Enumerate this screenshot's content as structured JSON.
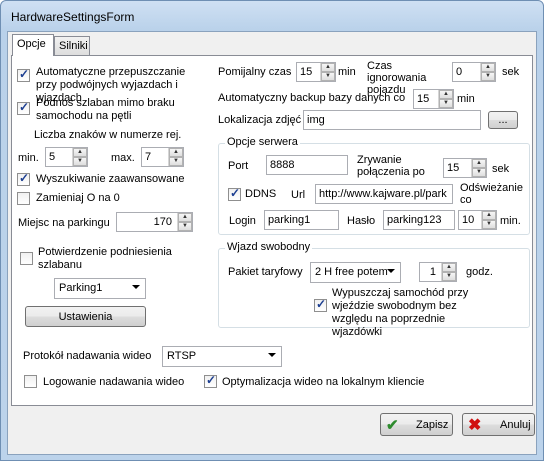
{
  "window": {
    "title": "HardwareSettingsForm"
  },
  "tabs": [
    {
      "label": "Opcje"
    },
    {
      "label": "Silniki"
    }
  ],
  "left": {
    "auto_pass": "Automatyczne przepuszczanie przy podwójnych wyjazdach i wjazdach",
    "raise_barrier": "Podnoś szlaban mimo braku samochodu na pętli",
    "plate_chars": "Liczba znaków w numerze rej.",
    "min_label": "min.",
    "min_value": "5",
    "max_label": "max.",
    "max_value": "7",
    "advanced_search": "Wyszukiwanie zaawansowane",
    "replace_o": "Zamieniaj O na 0",
    "parking_spaces_label": "Miejsc na parkingu",
    "parking_spaces_value": "170",
    "confirm_raise": "Potwierdzenie podniesienia szlabanu",
    "parking_select": "Parking1",
    "settings_button": "Ustawienia"
  },
  "right": {
    "photo_time_label": "Pomijalny czas",
    "photo_time_value": "15",
    "photo_time_unit": "min",
    "ignore_time_label": "Czas ignorowania pojazdu",
    "ignore_time_value": "0",
    "ignore_time_unit": "sek",
    "backup_label": "Automatyczny backup bazy danych co",
    "backup_value": "15",
    "backup_unit": "min",
    "photo_loc_label": "Lokalizacja zdjęć",
    "photo_loc_value": "img",
    "browse_button": "...",
    "server_group": "Opcje serwera",
    "port_label": "Port",
    "port_value": "8888",
    "drop_label": "Zrywanie połączenia po",
    "drop_value": "15",
    "drop_unit": "sek",
    "ddns_label": "DDNS",
    "url_label": "Url",
    "url_value": "http://www.kajware.pl/park",
    "refresh_label": "Odświeżanie co",
    "login_label": "Login",
    "login_value": "parking1",
    "password_label": "Hasło",
    "password_value": "parking123",
    "refresh_value": "10",
    "refresh_unit": "min.",
    "free_group": "Wjazd swobodny",
    "tariff_label": "Pakiet taryfowy",
    "tariff_value": "2 H free potem",
    "hours_value": "1",
    "hours_unit": "godz.",
    "release_label": "Wypuszczaj samochód przy wjeździe swobodnym bez względu na poprzednie wjazdówki"
  },
  "bottom": {
    "protocol_label": "Protokół nadawania wideo",
    "protocol_value": "RTSP",
    "log_video": "Logowanie nadawania wideo",
    "optimize_video": "Optymalizacja wideo na lokalnym kliencie"
  },
  "footer": {
    "save": "Zapisz",
    "cancel": "Anuluj"
  }
}
